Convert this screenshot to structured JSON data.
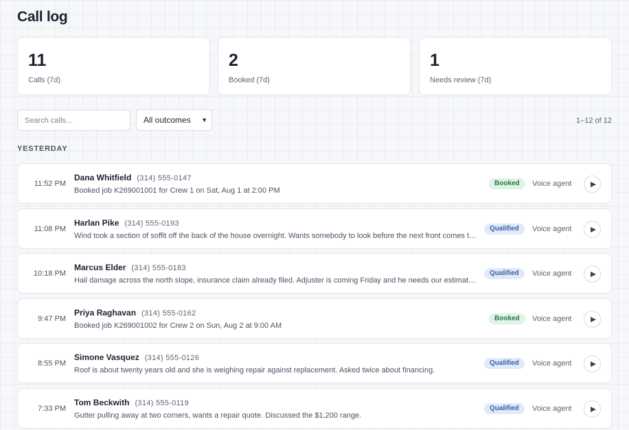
{
  "page": {
    "title": "Call log"
  },
  "stats": [
    {
      "value": "11",
      "label": "Calls (7d)"
    },
    {
      "value": "2",
      "label": "Booked (7d)"
    },
    {
      "value": "1",
      "label": "Needs review (7d)"
    }
  ],
  "filters": {
    "search_placeholder": "Search calls...",
    "outcome_selected": "All outcomes",
    "count_text": "1–12 of 12"
  },
  "section": {
    "label": "YESTERDAY"
  },
  "calls": [
    {
      "time": "11:52 PM",
      "name": "Dana Whitfield",
      "phone": "(314) 555-0147",
      "summary": "Booked job K269001001 for Crew 1 on Sat, Aug 1 at 2:00 PM",
      "outcome": "Booked",
      "agent": "Voice agent"
    },
    {
      "time": "11:08 PM",
      "name": "Harlan Pike",
      "phone": "(314) 555-0193",
      "summary": "Wind took a section of soffit off the back of the house overnight. Wants somebody to look before the next front comes through.",
      "outcome": "Qualified",
      "agent": "Voice agent"
    },
    {
      "time": "10:18 PM",
      "name": "Marcus Elder",
      "phone": "(314) 555-0183",
      "summary": "Hail damage across the north slope, insurance claim already filed. Adjuster is coming Friday and he needs our estimate before then.",
      "outcome": "Qualified",
      "agent": "Voice agent"
    },
    {
      "time": "9:47 PM",
      "name": "Priya Raghavan",
      "phone": "(314) 555-0162",
      "summary": "Booked job K269001002 for Crew 2 on Sun, Aug 2 at 9:00 AM",
      "outcome": "Booked",
      "agent": "Voice agent"
    },
    {
      "time": "8:55 PM",
      "name": "Simone Vasquez",
      "phone": "(314) 555-0126",
      "summary": "Roof is about twenty years old and she is weighing repair against replacement. Asked twice about financing.",
      "outcome": "Qualified",
      "agent": "Voice agent"
    },
    {
      "time": "7:33 PM",
      "name": "Tom Beckwith",
      "phone": "(314) 555-0119",
      "summary": "Gutter pulling away at two corners, wants a repair quote. Discussed the $1,200 range.",
      "outcome": "Qualified",
      "agent": "Voice agent"
    }
  ],
  "icons": {
    "play": "play-icon",
    "chevron": "chevron-down-icon"
  }
}
